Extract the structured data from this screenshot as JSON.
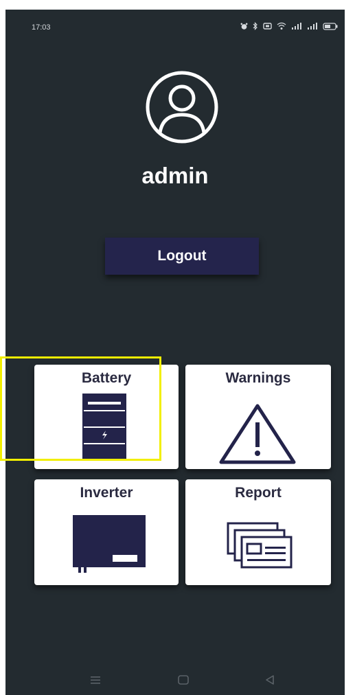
{
  "status_bar": {
    "time": "17:03",
    "icons": [
      "alarm-icon",
      "bluetooth-icon",
      "vibrate-icon",
      "wifi-icon",
      "signal-icon",
      "signal-icon",
      "battery-icon"
    ]
  },
  "profile": {
    "avatar_icon": "user-avatar-icon",
    "username": "admin"
  },
  "logout_label": "Logout",
  "tiles": {
    "battery": {
      "label": "Battery",
      "icon": "battery-rack-icon"
    },
    "warnings": {
      "label": "Warnings",
      "icon": "warning-triangle-icon"
    },
    "inverter": {
      "label": "Inverter",
      "icon": "inverter-icon"
    },
    "report": {
      "label": "Report",
      "icon": "report-cards-icon"
    }
  },
  "highlight_color": "#f2ef00",
  "colors": {
    "background": "#232b30",
    "accent": "#24244c",
    "tile": "#ffffff"
  },
  "nav_bar": {
    "icons": [
      "menu-icon",
      "home-icon",
      "back-icon"
    ]
  }
}
